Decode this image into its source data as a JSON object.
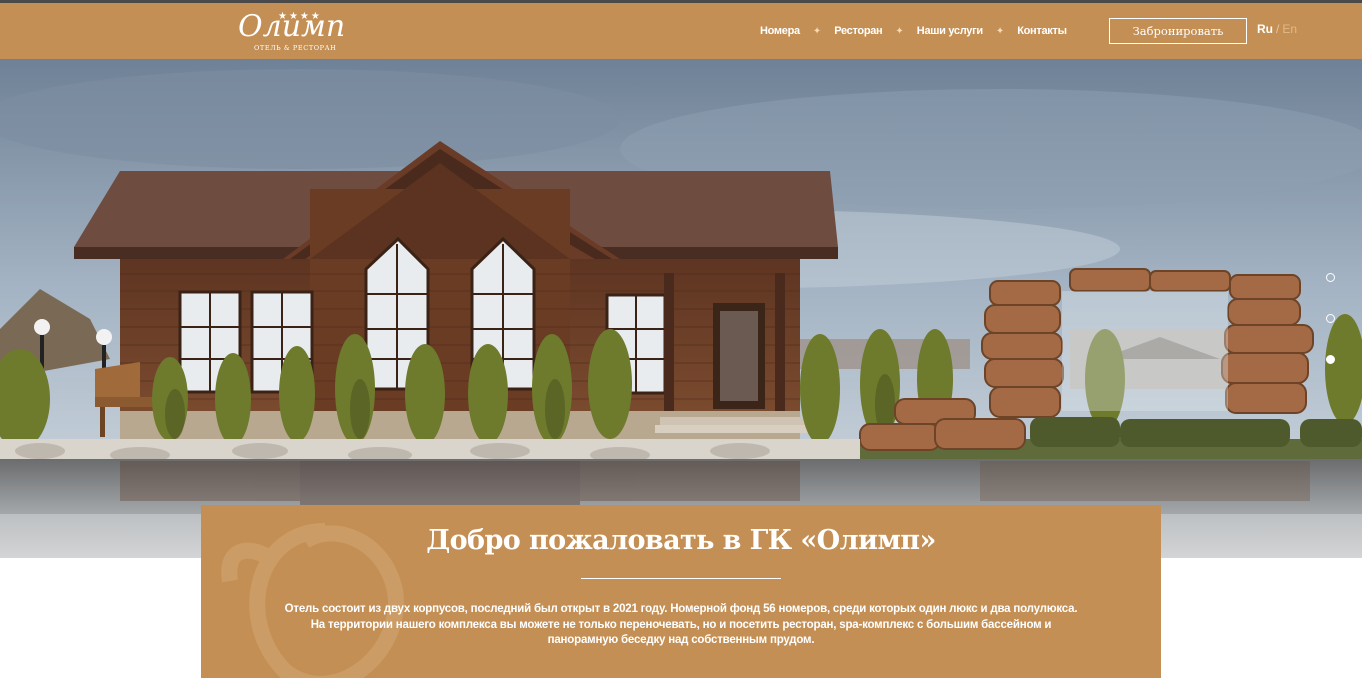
{
  "header": {
    "logo": {
      "script": "Олимп",
      "stars": "★★★★",
      "subtitle": "ОТЕЛЬ & РЕСТОРАН"
    },
    "nav": [
      {
        "label": "Номера"
      },
      {
        "label": "Ресторан"
      },
      {
        "label": "Наши услуги"
      },
      {
        "label": "Контакты"
      }
    ],
    "separator": "✦",
    "book_label": "Забронировать",
    "lang": {
      "ru": "Ru",
      "slash": "/",
      "en": "En"
    }
  },
  "colors": {
    "brand": "#c48f54",
    "topline": "#4a4a4a",
    "text": "#ffffff"
  },
  "slider": {
    "count": 3,
    "active_index": 2
  },
  "welcome": {
    "title": "Добро пожаловать в ГК «Олимп»",
    "text": "Отель состоит из двух корпусов, последний был открыт в 2021 году. Номерной фонд 56 номеров, среди которых один люкс и два полулюкса. На территории нашего комплекса вы можете не только переночевать, но и посетить ресторан, spa-комплекс с большим бассейном и панорамную беседку над собственным прудом."
  }
}
